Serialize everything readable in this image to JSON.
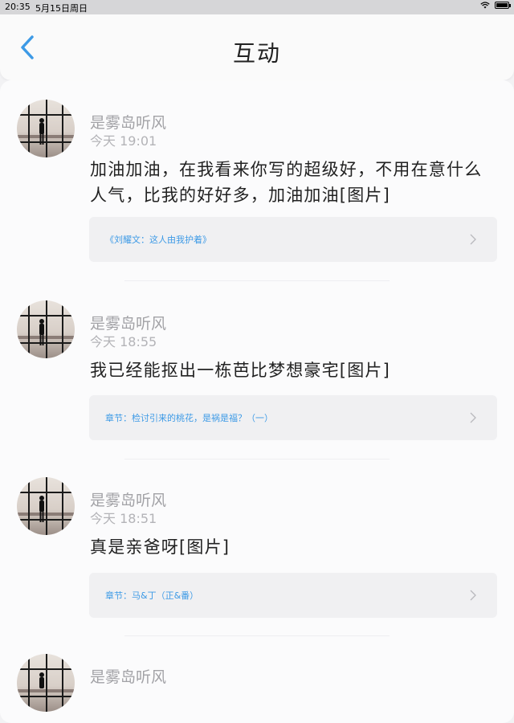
{
  "status_bar": {
    "time": "20:35",
    "date": "5月15日周日"
  },
  "nav": {
    "title": "互动"
  },
  "items": [
    {
      "username": "是雾岛听风",
      "time": "今天 19:01",
      "text": "加油加油，在我看来你写的超级好，不用在意什么人气，比我的好好多，加油加油[图片]",
      "ref": "《刘耀文：这人由我护着》"
    },
    {
      "username": "是雾岛听风",
      "time": "今天 18:55",
      "text": "我已经能抠出一栋芭比梦想豪宅[图片]",
      "ref": "章节：检讨引来的桃花，是祸是福？（一）"
    },
    {
      "username": "是雾岛听风",
      "time": "今天 18:51",
      "text": "真是亲爸呀[图片]",
      "ref": "章节：马&丁（正&番）"
    },
    {
      "username": "是雾岛听风"
    }
  ],
  "colors": {
    "accent": "#3d9ae6",
    "ref_text": "#3d9ae6",
    "muted": "#a2a2a6"
  }
}
